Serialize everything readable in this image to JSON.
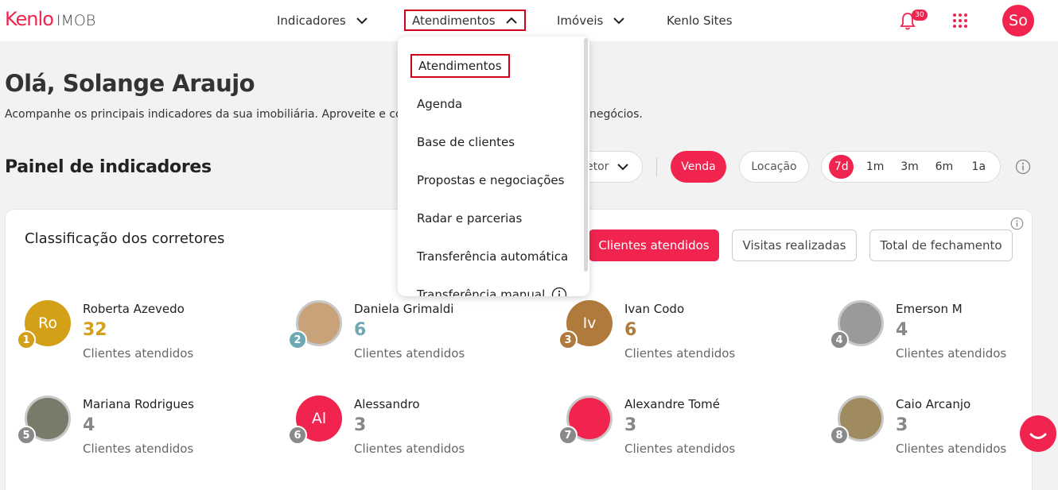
{
  "brand": {
    "logo_main": "Kenlo",
    "logo_sub": "IMOB",
    "accent": "#f0244e"
  },
  "nav": {
    "items": [
      {
        "label": "Indicadores"
      },
      {
        "label": "Atendimentos"
      },
      {
        "label": "Imóveis"
      },
      {
        "label": "Kenlo Sites"
      }
    ],
    "notification_count": "30",
    "user_initials": "So"
  },
  "dropdown": {
    "items": [
      {
        "label": "Atendimentos"
      },
      {
        "label": "Agenda"
      },
      {
        "label": "Base de clientes"
      },
      {
        "label": "Propostas e negociações"
      },
      {
        "label": "Radar e parcerias"
      },
      {
        "label": "Transferência automática"
      },
      {
        "label": "Transferência manual"
      }
    ]
  },
  "greeting": {
    "title": "Olá, Solange Araujo",
    "subtitle_start": "Acompanhe os principais indicadores da sua imobiliária. Aproveite e co",
    "subtitle_end": "negócios."
  },
  "panel": {
    "title": "Painel de indicadores",
    "corretor_filter_partial": "etor",
    "venda_label": "Venda",
    "locacao_label": "Locação",
    "periods": [
      "7d",
      "1m",
      "3m",
      "6m",
      "1a"
    ],
    "active_period": "7d"
  },
  "ranking": {
    "title": "Classificação dos corretores",
    "tabs": [
      "Clientes atendidos",
      "Visitas realizadas",
      "Total de fechamento"
    ],
    "active_tab": "Clientes atendidos",
    "items": [
      {
        "pos": "1",
        "name": "Roberta Azevedo",
        "value": "32",
        "label": "Clientes atendidos",
        "initials": "Ro",
        "avatar_color": "#d4a017",
        "badge_color": "#d4a017",
        "value_color": "#d4a017"
      },
      {
        "pos": "2",
        "name": "Daniela Grimaldi",
        "value": "6",
        "label": "Clientes atendidos",
        "initials": "",
        "avatar_color": "#c9a27a",
        "badge_color": "#6fa8b5",
        "value_color": "#6fa8b5"
      },
      {
        "pos": "3",
        "name": "Ivan Codo",
        "value": "6",
        "label": "Clientes atendidos",
        "initials": "Iv",
        "avatar_color": "#b07a3c",
        "badge_color": "#b07a3c",
        "value_color": "#b07a3c"
      },
      {
        "pos": "4",
        "name": "Emerson M",
        "value": "4",
        "label": "Clientes atendidos",
        "initials": "",
        "avatar_color": "#9a9a9a",
        "badge_color": "#8a8a8a",
        "value_color": "#888888"
      },
      {
        "pos": "5",
        "name": "Mariana Rodrigues",
        "value": "4",
        "label": "Clientes atendidos",
        "initials": "",
        "avatar_color": "#7a7a6a",
        "badge_color": "#8a8a8a",
        "value_color": "#888888"
      },
      {
        "pos": "6",
        "name": "Alessandro",
        "value": "3",
        "label": "Clientes atendidos",
        "initials": "Al",
        "avatar_color": "#f0244e",
        "badge_color": "#8a8a8a",
        "value_color": "#888888"
      },
      {
        "pos": "7",
        "name": "Alexandre Tomé",
        "value": "3",
        "label": "Clientes atendidos",
        "initials": "",
        "avatar_color": "#f0244e",
        "badge_color": "#8a8a8a",
        "value_color": "#888888"
      },
      {
        "pos": "8",
        "name": "Caio Arcanjo",
        "value": "3",
        "label": "Clientes atendidos",
        "initials": "",
        "avatar_color": "#a08a60",
        "badge_color": "#8a8a8a",
        "value_color": "#888888"
      }
    ]
  }
}
